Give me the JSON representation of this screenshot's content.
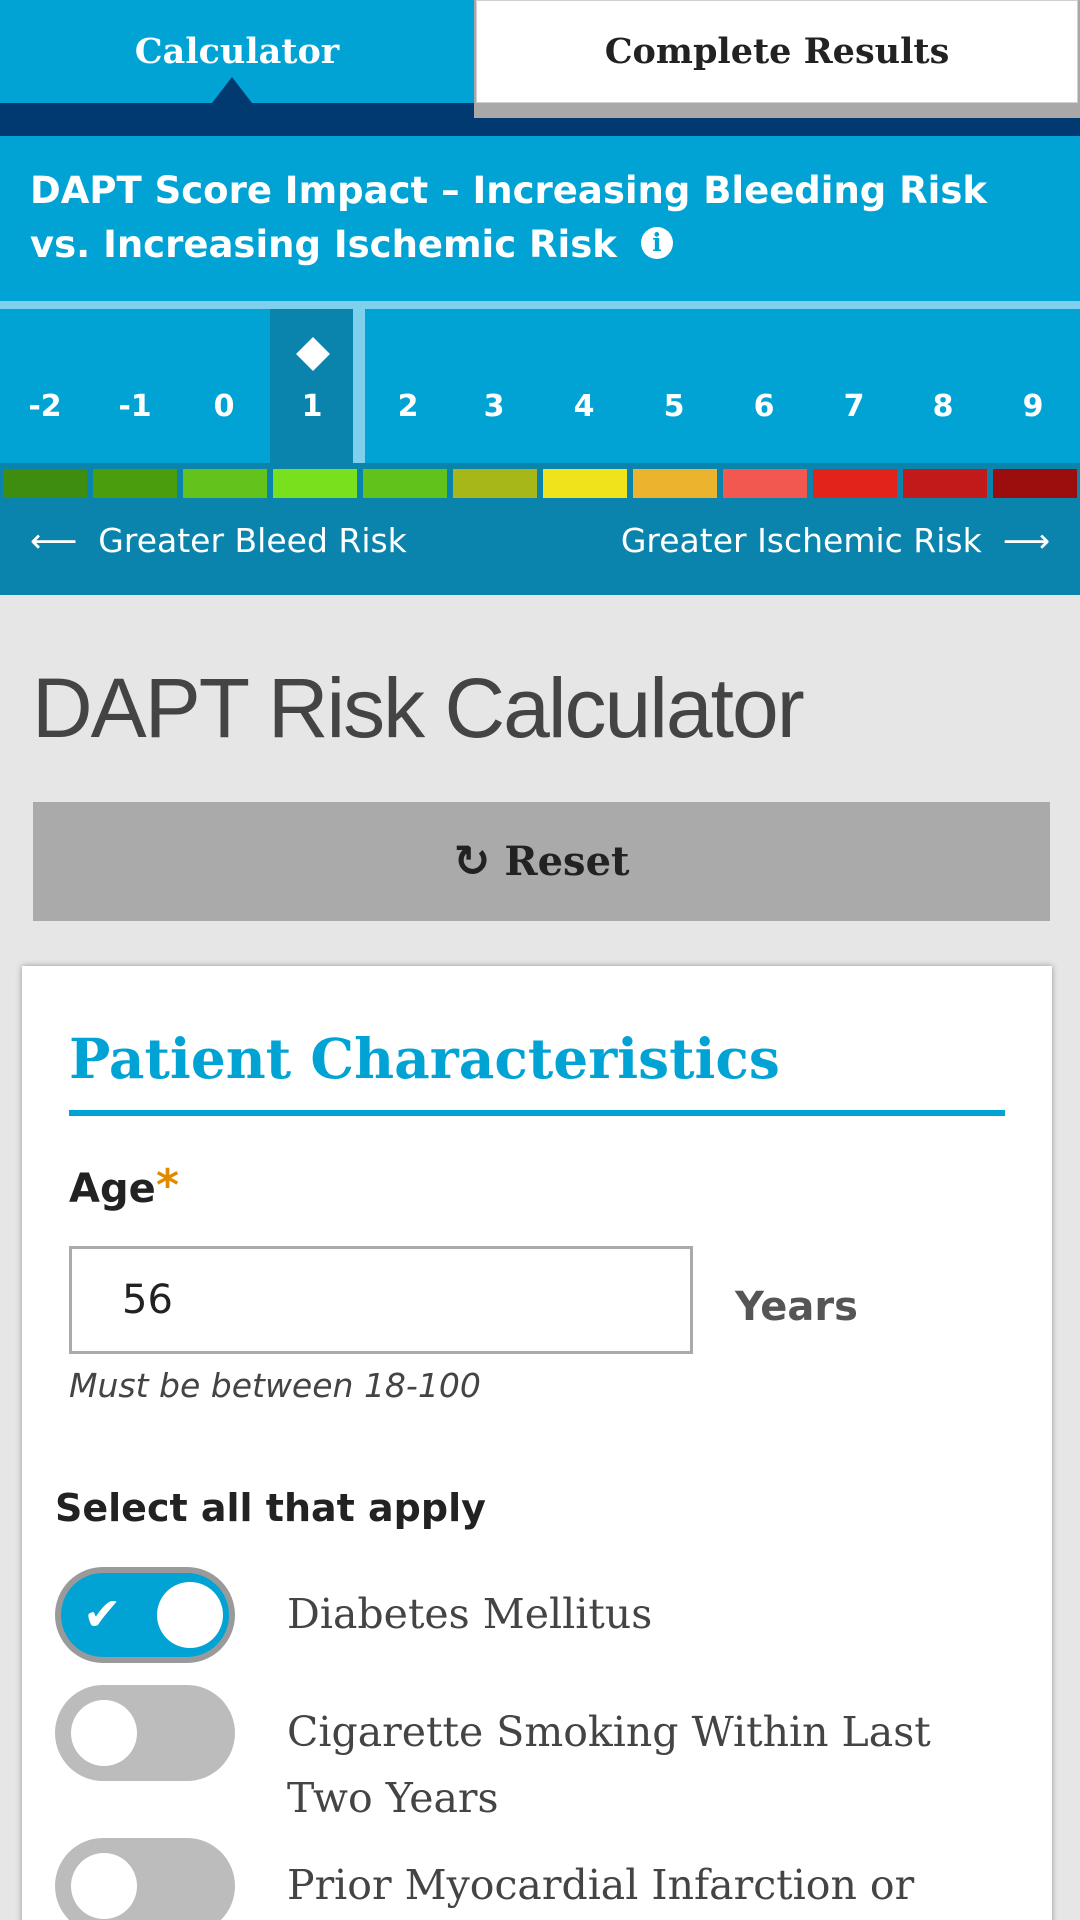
{
  "tabs": {
    "calculator": "Calculator",
    "complete_results": "Complete Results"
  },
  "score_panel": {
    "title": "DAPT Score Impact – Increasing Bleeding Risk vs. Increasing Ischemic Risk",
    "info_icon": "info-icon",
    "scale_values": [
      "-2",
      "-1",
      "0",
      "1",
      "2",
      "3",
      "4",
      "5",
      "6",
      "7",
      "8",
      "9"
    ],
    "selected_score": "1",
    "segment_colors": [
      "#3f8d0f",
      "#4a9e0d",
      "#64c21c",
      "#78e01d",
      "#60c21a",
      "#a7b718",
      "#f0e31b",
      "#ebb32e",
      "#f35850",
      "#e2231c",
      "#c21a1a",
      "#9c0d0d"
    ],
    "left_label": "Greater Bleed Risk",
    "right_label": "Greater Ischemic Risk"
  },
  "page": {
    "title": "DAPT Risk Calculator",
    "reset_label": "Reset"
  },
  "card": {
    "title": "Patient Characteristics",
    "age_label": "Age",
    "required_mark": "*",
    "age_value": "56",
    "age_unit": "Years",
    "age_hint": "Must be between 18-100",
    "select_label": "Select all that apply",
    "options": [
      {
        "label": "Diabetes Mellitus",
        "checked": true
      },
      {
        "label": "Cigarette Smoking Within Last Two Years",
        "checked": false
      },
      {
        "label": "Prior Myocardial Infarction or",
        "checked": false
      }
    ]
  },
  "colors": {
    "accent": "#00a3d4",
    "dark_navy": "#003a70",
    "required_star": "#e08a00"
  }
}
